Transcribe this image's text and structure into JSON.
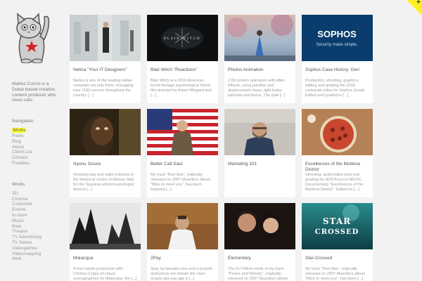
{
  "bio": "Matteo Curcio is a Dubai based creative content producer who loves cats.",
  "navigation": {
    "heading": "Navigation",
    "items": [
      {
        "label": "Works",
        "active": true
      },
      {
        "label": "Reels"
      },
      {
        "label": "Blog"
      },
      {
        "label": "About"
      },
      {
        "label": "Client List"
      },
      {
        "label": "Contact"
      },
      {
        "label": "Freebies"
      }
    ]
  },
  "works": {
    "heading": "Works",
    "items": [
      "3D",
      "Cinema",
      "Corporate",
      "Events",
      "In-store",
      "Music",
      "Reel",
      "Theatre",
      "TV Advertising",
      "TV Series",
      "Videogames",
      "Videomapping",
      "Web"
    ]
  },
  "corner_icon": "plus-icon",
  "corner_symbol": "+",
  "cards": [
    {
      "title": "Netica \"Your IT Designers\"",
      "text": "Netica is one of the leading Italian computer security firms, managing over 1160 servers throughout the country. [...]"
    },
    {
      "title": "Blair Witch \"Reactions\"",
      "text": "Blair Witch is a 2016 American found footage psychological horror film directed by Adam Wingard and [...]",
      "overlay": "BLAIR WITCH"
    },
    {
      "title": "Photos Animation",
      "text": "2.5D photos animation with After Effects, using parallax and displacement maps, light leaks, particles and burns. The goal [...]"
    },
    {
      "title": "Sophos Case History: Geri",
      "text": "Production, shooting, graphics, editing and grading the 2016 corporate video for Sophos Group. Edited and graded in [...]",
      "overlay": "SOPHOS",
      "overlay2": "Security made simple."
    },
    {
      "title": "Nyonu Sciura",
      "text": "Shooting day and night exteriors in the historical centre of Monza, Italy for the Togolese ethnomusicologist Arsene [...]"
    },
    {
      "title": "Better Call Saul",
      "text": "My track \"Red Star\", originally released on 2007 Musetta's album \"Mice to meet you\", has been featured [...]"
    },
    {
      "title": "Marketing 101",
      "text": ""
    },
    {
      "title": "Excellences of the Modena District",
      "text": "Shooting, audio/video post and grading for SDA Bocconi MOOC Documentary \"Excellences of the Modena District\". Edited on [...]"
    },
    {
      "title": "Malacqua",
      "text": "A four hands production with Cristina Crippa of virtual scenographies for Malacqua, the [...]"
    },
    {
      "title": "2Pay",
      "text": "2pay ha lanciato una vera e propria rivoluzione nel mondo del cash. Grazie alla sua app è [...]"
    },
    {
      "title": "Elementary",
      "text": "The DJ Yellow remix of my track \"Peace and Melody\", originally released on 2007 Musetta's album [...]"
    },
    {
      "title": "Star-Crossed",
      "text": "My track \"Red Star\", originally released on 2007 Musetta's album \"Mice to meet you\", has been [...]",
      "overlay": "STAR",
      "overlay2": "CROSSED"
    }
  ]
}
